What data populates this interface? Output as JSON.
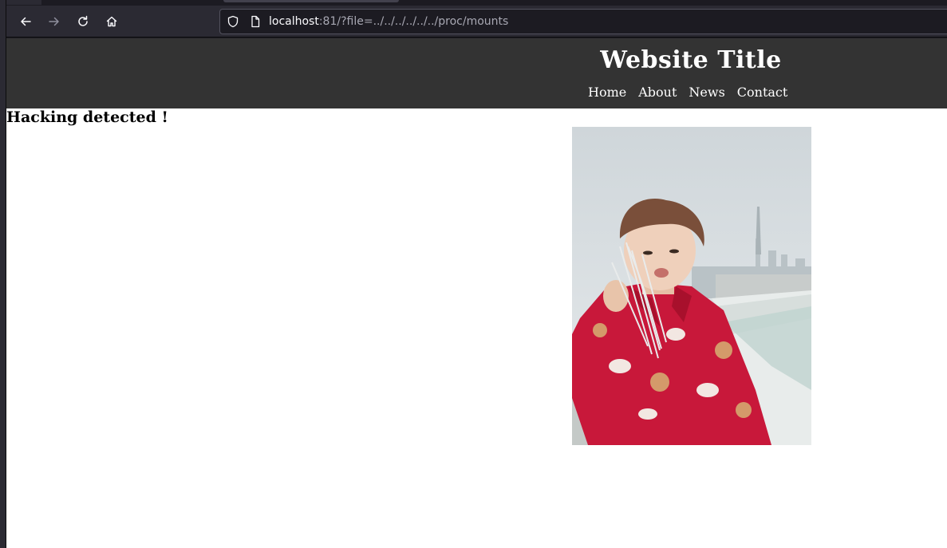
{
  "browser": {
    "url_host": "localhost",
    "url_rest": ":81/?file=../../../../../../proc/mounts",
    "icons": {
      "back": "arrow-left-icon",
      "forward": "arrow-right-icon",
      "reload": "reload-icon",
      "home": "home-icon",
      "tracking": "shield-icon",
      "page": "page-icon"
    }
  },
  "site": {
    "title": "Website Title",
    "nav": [
      "Home",
      "About",
      "News",
      "Contact"
    ],
    "message": "Hacking detected !",
    "header_color": "#333333"
  }
}
